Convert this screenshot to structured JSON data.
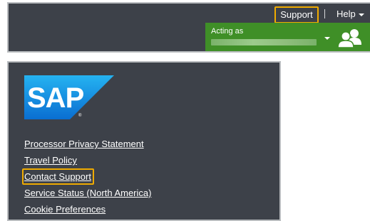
{
  "header": {
    "support_label": "Support",
    "help_label": "Help",
    "acting_as_label": "Acting as",
    "acting_as_value": "",
    "acting_as_color": "#3f8f27"
  },
  "footer": {
    "logo_text": "SAP",
    "links": [
      {
        "label": "Processor Privacy Statement",
        "highlighted": false
      },
      {
        "label": "Travel Policy",
        "highlighted": false
      },
      {
        "label": "Contact Support",
        "highlighted": true
      },
      {
        "label": "Service Status (North America)",
        "highlighted": false
      },
      {
        "label": "Cookie Preferences",
        "highlighted": false
      }
    ]
  },
  "colors": {
    "bar_background": "#3d4149",
    "highlight_outline": "#f0ab00",
    "sap_blue": "#0a6ed1"
  },
  "icons": {
    "help_caret": "chevron-down-icon",
    "acting_caret": "chevron-down-icon",
    "user_group": "user-group-icon"
  }
}
